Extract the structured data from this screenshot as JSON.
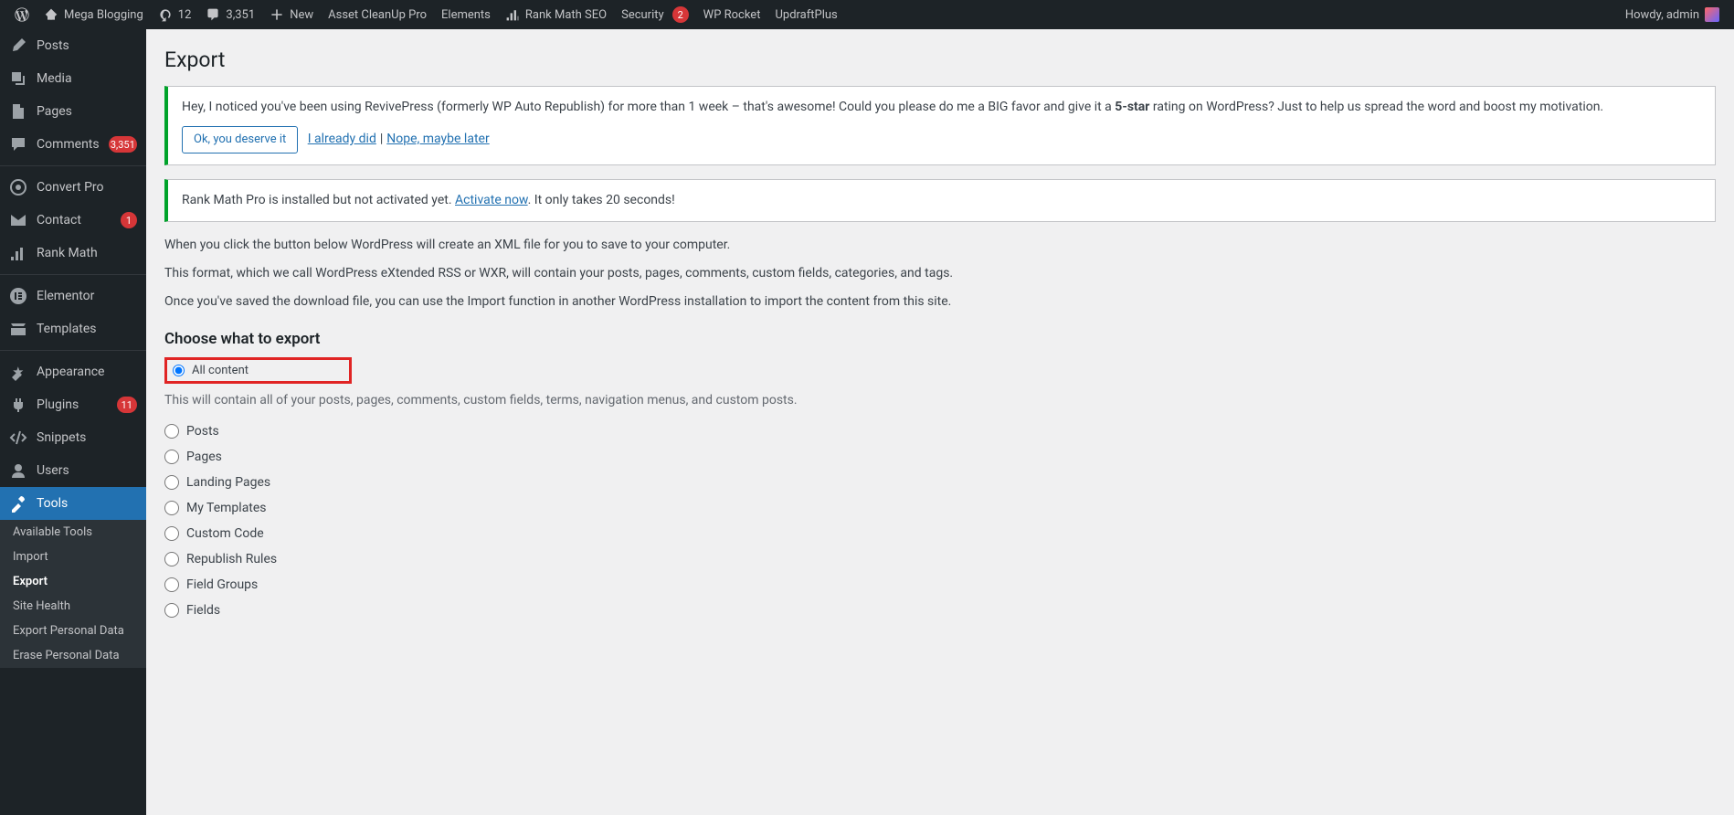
{
  "adminbar": {
    "site_name": "Mega Blogging",
    "updates": "12",
    "comments": "3,351",
    "new": "New",
    "items": [
      "Asset CleanUp Pro",
      "Elements",
      "Rank Math SEO",
      "Security",
      "WP Rocket",
      "UpdraftPlus"
    ],
    "security_badge": "2",
    "howdy": "Howdy, admin"
  },
  "menu": {
    "posts": "Posts",
    "media": "Media",
    "pages": "Pages",
    "comments": "Comments",
    "comments_badge": "3,351",
    "convertpro": "Convert Pro",
    "contact": "Contact",
    "contact_badge": "1",
    "rankmath": "Rank Math",
    "elementor": "Elementor",
    "templates": "Templates",
    "appearance": "Appearance",
    "plugins": "Plugins",
    "plugins_badge": "11",
    "snippets": "Snippets",
    "users": "Users",
    "tools": "Tools",
    "sub": {
      "available": "Available Tools",
      "import": "Import",
      "export": "Export",
      "sitehealth": "Site Health",
      "export_pd": "Export Personal Data",
      "erase_pd": "Erase Personal Data"
    }
  },
  "page": {
    "title": "Export",
    "notice1_text": "Hey, I noticed you've been using RevivePress (formerly WP Auto Republish) for more than 1 week – that's awesome! Could you please do me a BIG favor and give it a ",
    "notice1_bold": "5-star",
    "notice1_text2": " rating on WordPress? Just to help us spread the word and boost my motivation.",
    "ok": "Ok, you deserve it",
    "already": "I already did",
    "later": "Nope, maybe later",
    "notice2_a": "Rank Math Pro is installed but not activated yet. ",
    "notice2_link": "Activate now",
    "notice2_b": ". It only takes 20 seconds!",
    "p1": "When you click the button below WordPress will create an XML file for you to save to your computer.",
    "p2": "This format, which we call WordPress eXtended RSS or WXR, will contain your posts, pages, comments, custom fields, categories, and tags.",
    "p3": "Once you've saved the download file, you can use the Import function in another WordPress installation to import the content from this site.",
    "h2": "Choose what to export",
    "all": "All content",
    "all_desc": "This will contain all of your posts, pages, comments, custom fields, terms, navigation menus, and custom posts.",
    "opts": [
      "Posts",
      "Pages",
      "Landing Pages",
      "My Templates",
      "Custom Code",
      "Republish Rules",
      "Field Groups",
      "Fields"
    ]
  }
}
